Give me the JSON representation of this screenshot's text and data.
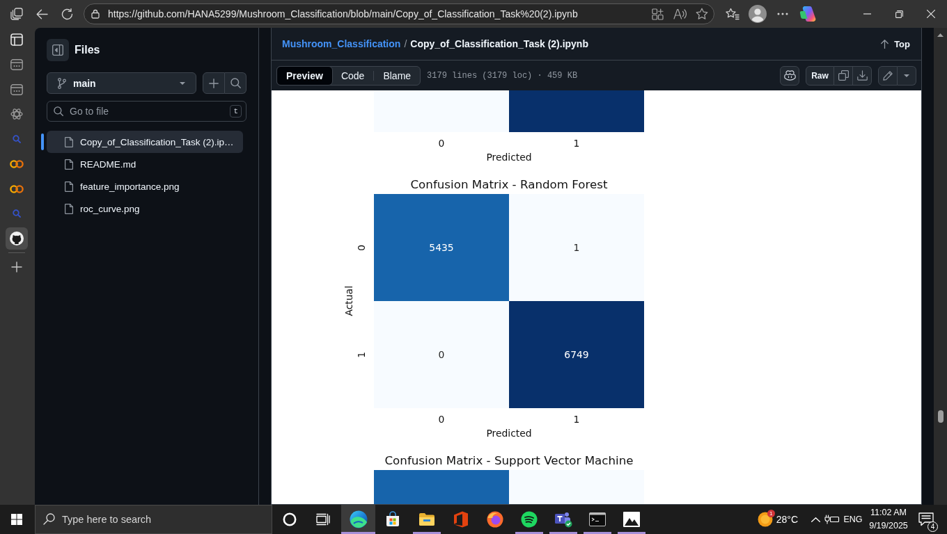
{
  "browser": {
    "url": "https://github.com/HANA5299/Mushroom_Classification/blob/main/Copy_of_Classification_Task%20(2).ipynb"
  },
  "edge_sidebar": {
    "items": [
      {
        "kind": "tabs",
        "selected": false
      },
      {
        "kind": "app",
        "selected": false
      },
      {
        "kind": "app",
        "selected": false
      },
      {
        "kind": "knot",
        "selected": false
      },
      {
        "kind": "search",
        "selected": false
      },
      {
        "kind": "rings",
        "selected": false
      },
      {
        "kind": "rings",
        "selected": false
      },
      {
        "kind": "search",
        "selected": false
      },
      {
        "kind": "cat",
        "selected": true
      },
      {
        "kind": "add",
        "selected": false
      }
    ]
  },
  "files_panel": {
    "title": "Files",
    "branch": "main",
    "file_search": {
      "placeholder": "Go to file",
      "shortcut": "t"
    },
    "items": [
      {
        "name": "Copy_of_Classification_Task (2).ip…",
        "selected": true
      },
      {
        "name": "README.md",
        "selected": false
      },
      {
        "name": "feature_importance.png",
        "selected": false
      },
      {
        "name": "roc_curve.png",
        "selected": false
      }
    ]
  },
  "file_view": {
    "breadcrumb": {
      "repo": "Mushroom_Classification",
      "separator": "/",
      "file": "Copy_of_Classification_Task (2).ipynb"
    },
    "top_link": "Top",
    "view_tabs": [
      {
        "label": "Preview",
        "selected": true
      },
      {
        "label": "Code",
        "selected": false
      },
      {
        "label": "Blame",
        "selected": false
      }
    ],
    "file_info": "3179 lines (3179 loc) · 459 KB",
    "raw_button": "Raw"
  },
  "notebook": {
    "figures": [
      {
        "matrix": [
          [
            {
              "color": "#f7fbff"
            },
            {
              "color": "#08306b"
            }
          ]
        ],
        "xticks": [
          "0",
          "1"
        ],
        "xlabel": "Predicted"
      },
      {
        "title": "Confusion Matrix - Random Forest",
        "ylabel": "Actual",
        "yticks": [
          "0",
          "1"
        ],
        "matrix": [
          [
            {
              "value": "5435",
              "color": "#1764ab"
            },
            {
              "value": "1",
              "color": "#f7fbff"
            }
          ],
          [
            {
              "value": "0",
              "color": "#f7fbff"
            },
            {
              "value": "6749",
              "color": "#08306b"
            }
          ]
        ],
        "xticks": [
          "0",
          "1"
        ],
        "xlabel": "Predicted"
      },
      {
        "title": "Confusion Matrix - Support Vector Machine",
        "matrix": [
          [
            {
              "color": "#1764ab"
            },
            {
              "color": "#f7fbff"
            }
          ]
        ]
      }
    ]
  },
  "taskbar": {
    "search": {
      "placeholder": "Type here to search"
    },
    "apps": [
      {
        "kind": "browser",
        "selected": true,
        "running": true
      },
      {
        "kind": "store",
        "selected": false,
        "running": false
      },
      {
        "kind": "folder",
        "selected": false,
        "running": true
      },
      {
        "kind": "office",
        "selected": false,
        "running": false
      },
      {
        "kind": "firefox",
        "selected": false,
        "running": false
      },
      {
        "kind": "music",
        "selected": false,
        "running": true
      },
      {
        "kind": "teams",
        "selected": false,
        "running": true
      },
      {
        "kind": "terminal",
        "selected": false,
        "running": true
      },
      {
        "kind": "photos",
        "selected": false,
        "running": true
      }
    ],
    "weather": {
      "badge": "1",
      "temperature": "28°C"
    },
    "language": "ENG",
    "time": "11:02 AM",
    "date": "9/19/2025",
    "notification_count": "4"
  }
}
